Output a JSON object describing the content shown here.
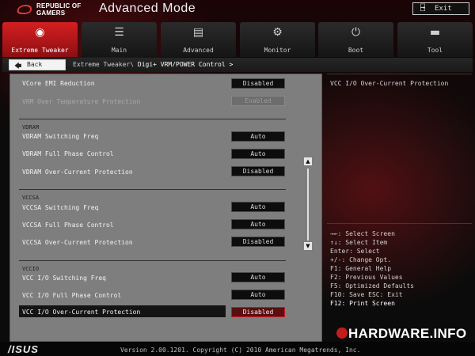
{
  "header": {
    "logo_line1": "REPUBLIC OF",
    "logo_line2": "GAMERS",
    "title": "Advanced Mode",
    "exit_label": "Exit",
    "exit_icon": "door-exit-icon"
  },
  "tabs": [
    {
      "label": "Extreme Tweaker",
      "icon": "gauge-icon",
      "glyph": "◉",
      "active": true
    },
    {
      "label": "Main",
      "icon": "list-icon",
      "glyph": "☰",
      "active": false
    },
    {
      "label": "Advanced",
      "icon": "advanced-icon",
      "glyph": "▤",
      "active": false
    },
    {
      "label": "Monitor",
      "icon": "monitor-gauge-icon",
      "glyph": "⚙",
      "active": false
    },
    {
      "label": "Boot",
      "icon": "power-icon",
      "glyph": "⏻",
      "active": false
    },
    {
      "label": "Tool",
      "icon": "toolbox-icon",
      "glyph": "▬",
      "active": false
    }
  ],
  "breadcrumb": {
    "back_label": "Back",
    "path": "Extreme Tweaker\\",
    "current": " Digi+ VRM/POWER Control >"
  },
  "settings": {
    "top": [
      {
        "label": "VCore EMI Reduction",
        "value": "Disabled",
        "state": "normal"
      },
      {
        "label": "VRM Over Temperature Protection",
        "value": "Enabled",
        "state": "disabled"
      }
    ],
    "vdram": {
      "group": "VDRAM",
      "rows": [
        {
          "label": "VDRAM Switching Freq",
          "value": "Auto"
        },
        {
          "label": "VDRAM Full Phase Control",
          "value": "Auto"
        },
        {
          "label": "VDRAM Over-Current Protection",
          "value": "Disabled"
        }
      ]
    },
    "vccsa": {
      "group": "VCCSA",
      "rows": [
        {
          "label": "VCCSA Switching Freq",
          "value": "Auto"
        },
        {
          "label": "VCCSA Full Phase Control",
          "value": "Auto"
        },
        {
          "label": "VCCSA Over-Current Protection",
          "value": "Disabled"
        }
      ]
    },
    "vccio": {
      "group": "VCCIO",
      "rows": [
        {
          "label": "VCC I/O Switching Freq",
          "value": "Auto"
        },
        {
          "label": "VCC I/O Full Phase Control",
          "value": "Auto"
        },
        {
          "label": "VCC I/O Over-Current Protection",
          "value": "Disabled"
        }
      ]
    }
  },
  "help": {
    "description": "VCC I/O Over-Current Protection",
    "keys": [
      "→←: Select Screen",
      "↑↓: Select Item",
      "Enter: Select",
      "+/-: Change Opt.",
      "F1: General Help",
      "F2: Previous Values",
      "F5: Optimized Defaults",
      "F10: Save  ESC: Exit",
      "F12: Print Screen"
    ]
  },
  "footer": {
    "brand": "/ISUS",
    "version": "Version 2.00.1201. Copyright (C) 2010 American Megatrends, Inc.",
    "watermark": "HARDWARE.INFO"
  },
  "colors": {
    "accent": "#d41f21",
    "panel": "#7e7e7e",
    "background": "#0b0b0b"
  }
}
